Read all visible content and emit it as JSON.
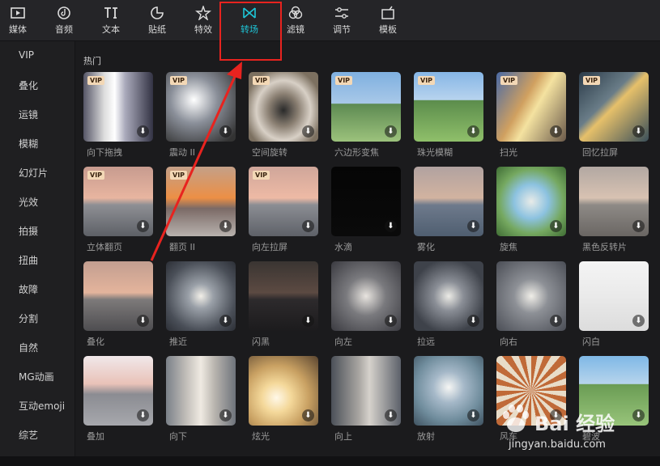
{
  "tabs": [
    {
      "label": "媒体",
      "icon": "media-icon"
    },
    {
      "label": "音频",
      "icon": "audio-icon"
    },
    {
      "label": "文本",
      "icon": "text-icon"
    },
    {
      "label": "贴纸",
      "icon": "sticker-icon"
    },
    {
      "label": "特效",
      "icon": "effects-icon"
    },
    {
      "label": "转场",
      "icon": "transition-icon",
      "active": true
    },
    {
      "label": "滤镜",
      "icon": "filter-icon"
    },
    {
      "label": "调节",
      "icon": "adjust-icon"
    },
    {
      "label": "模板",
      "icon": "template-icon"
    }
  ],
  "sidebar": [
    "VIP",
    "叠化",
    "运镜",
    "模糊",
    "幻灯片",
    "光效",
    "拍摄",
    "扭曲",
    "故障",
    "分割",
    "自然",
    "MG动画",
    "互动emoji",
    "综艺"
  ],
  "section_title": "热门",
  "vip_badge": "VIP",
  "download_glyph": "⬇",
  "rows": [
    [
      {
        "label": "向下拖拽",
        "vip": true
      },
      {
        "label": "震动 II",
        "vip": true
      },
      {
        "label": "空间旋转",
        "vip": true
      },
      {
        "label": "六边形变焦",
        "vip": true
      },
      {
        "label": "珠光模糊",
        "vip": true
      },
      {
        "label": "扫光",
        "vip": true
      },
      {
        "label": "回忆拉屏",
        "vip": true
      }
    ],
    [
      {
        "label": "立体翻页",
        "vip": true
      },
      {
        "label": "翻页 II",
        "vip": true
      },
      {
        "label": "向左拉屏",
        "vip": true
      },
      {
        "label": "水滴",
        "vip": false
      },
      {
        "label": "雾化",
        "vip": false
      },
      {
        "label": "旋焦",
        "vip": false
      },
      {
        "label": "黑色反转片",
        "vip": false
      }
    ],
    [
      {
        "label": "叠化",
        "vip": false
      },
      {
        "label": "推近",
        "vip": false
      },
      {
        "label": "闪黑",
        "vip": false
      },
      {
        "label": "向左",
        "vip": false
      },
      {
        "label": "拉远",
        "vip": false
      },
      {
        "label": "向右",
        "vip": false
      },
      {
        "label": "闪白",
        "vip": false
      }
    ],
    [
      {
        "label": "叠加",
        "vip": false
      },
      {
        "label": "向下",
        "vip": false
      },
      {
        "label": "炫光",
        "vip": false
      },
      {
        "label": "向上",
        "vip": false
      },
      {
        "label": "放射",
        "vip": false
      },
      {
        "label": "风车",
        "vip": false
      },
      {
        "label": "碧波",
        "vip": false
      }
    ]
  ],
  "watermark": {
    "brand": "Bai 经验",
    "url": "jingyan.baidu.com"
  }
}
